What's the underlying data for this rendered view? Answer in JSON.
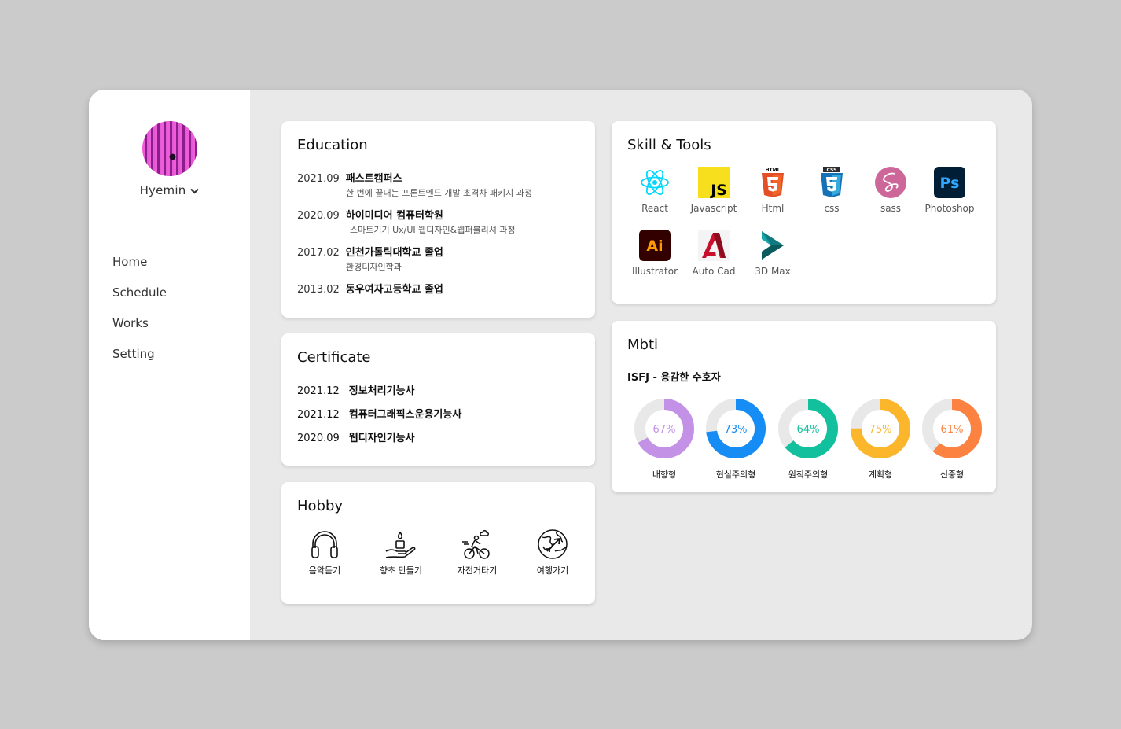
{
  "profile": {
    "name": "Hyemin"
  },
  "nav": {
    "items": [
      "Home",
      "Schedule",
      "Works",
      "Setting"
    ]
  },
  "education": {
    "title": "Education",
    "items": [
      {
        "year": "2021.09",
        "name": "패스트캠퍼스",
        "desc": "한 번에 끝내는 프론트엔드 개발 초격차 패키지 과정"
      },
      {
        "year": "2020.09",
        "name": "하이미디어 컴퓨터학원",
        "desc": "스마트기기 Ux/UI 웹디자인&웹퍼블리셔 과정"
      },
      {
        "year": "2017.02",
        "name": "인천가톨릭대학교 졸업",
        "desc": "환경디자인학과"
      },
      {
        "year": "2013.02",
        "name": "동우여자고등학교 졸업",
        "desc": ""
      }
    ]
  },
  "certificate": {
    "title": "Certificate",
    "items": [
      {
        "year": "2021.12",
        "name": "정보처리기능사"
      },
      {
        "year": "2021.12",
        "name": "컴퓨터그래픽스운용기능사"
      },
      {
        "year": "2020.09",
        "name": "웹디자인기능사"
      }
    ]
  },
  "hobby": {
    "title": "Hobby",
    "items": [
      {
        "icon": "headphones-icon",
        "label": "음악듣기"
      },
      {
        "icon": "candle-hand-icon",
        "label": "향초 만들기"
      },
      {
        "icon": "bicycle-icon",
        "label": "자전거타기"
      },
      {
        "icon": "globe-plane-icon",
        "label": "여행가기"
      }
    ]
  },
  "skills": {
    "title": "Skill & Tools",
    "items": [
      {
        "icon": "react-icon",
        "label": "React"
      },
      {
        "icon": "javascript-icon",
        "label": "Javascript"
      },
      {
        "icon": "html5-icon",
        "label": "Html"
      },
      {
        "icon": "css3-icon",
        "label": "css"
      },
      {
        "icon": "sass-icon",
        "label": "sass"
      },
      {
        "icon": "photoshop-icon",
        "label": "Photoshop"
      },
      {
        "icon": "illustrator-icon",
        "label": "Illustrator"
      },
      {
        "icon": "autocad-icon",
        "label": "Auto Cad"
      },
      {
        "icon": "3dsmax-icon",
        "label": "3D Max"
      }
    ],
    "badge_text": {
      "js": "JS",
      "html": "HTML",
      "css": "CSS",
      "ps": "Ps",
      "ai": "Ai"
    }
  },
  "mbti": {
    "title": "Mbti",
    "type": "ISFJ - 용감한 수호자",
    "traits": [
      {
        "label": "내향형",
        "value": 67,
        "text": "67%",
        "color": "#c391e6"
      },
      {
        "label": "현실주의형",
        "value": 73,
        "text": "73%",
        "color": "#168cf5"
      },
      {
        "label": "원칙주의형",
        "value": 64,
        "text": "64%",
        "color": "#13c09d"
      },
      {
        "label": "계획형",
        "value": 75,
        "text": "75%",
        "color": "#fbb62c"
      },
      {
        "label": "신중형",
        "value": 61,
        "text": "61%",
        "color": "#fb8240"
      }
    ]
  }
}
